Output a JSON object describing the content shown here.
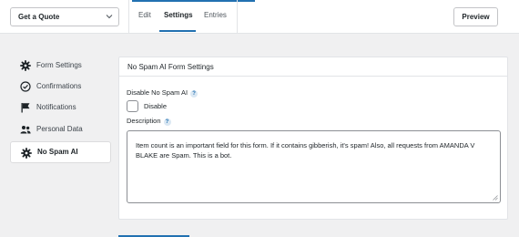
{
  "header": {
    "form_selector_value": "Get a Quote",
    "tabs": [
      {
        "label": "Edit",
        "active": false
      },
      {
        "label": "Settings",
        "active": true
      },
      {
        "label": "Entries",
        "active": false
      }
    ],
    "preview_label": "Preview"
  },
  "sidebar": {
    "items": [
      {
        "label": "Form Settings",
        "icon": "gear-icon",
        "active": false
      },
      {
        "label": "Confirmations",
        "icon": "check-circle-icon",
        "active": false
      },
      {
        "label": "Notifications",
        "icon": "flag-icon",
        "active": false
      },
      {
        "label": "Personal Data",
        "icon": "users-icon",
        "active": false
      },
      {
        "label": "No Spam AI",
        "icon": "gear-icon",
        "active": true
      }
    ]
  },
  "panel": {
    "title": "No Spam AI Form Settings",
    "disable_label": "Disable No Spam AI",
    "help_glyph": "?",
    "checkbox_label": "Disable",
    "checkbox_checked": false,
    "description_label": "Description",
    "description_value": "Item count is an important field for this form. If it contains gibberish, it's spam! Also, all requests from AMANDA V BLAKE are Spam. This is a bot."
  },
  "colors": {
    "accent": "#2271b1",
    "background": "#f0f0f1"
  }
}
